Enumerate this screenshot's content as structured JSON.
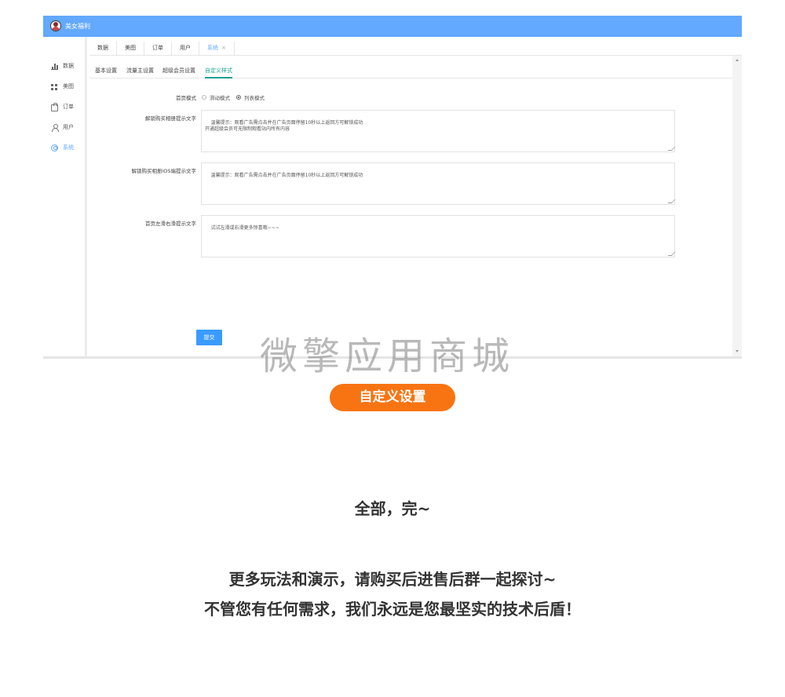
{
  "app": {
    "title": "美女福利"
  },
  "sidebar": {
    "items": [
      {
        "label": "数据",
        "icon": "bar-chart-icon"
      },
      {
        "label": "美图",
        "icon": "grid-icon"
      },
      {
        "label": "订单",
        "icon": "bag-icon"
      },
      {
        "label": "用户",
        "icon": "user-icon"
      },
      {
        "label": "系统",
        "icon": "gear-icon",
        "active": true
      }
    ]
  },
  "tabs": [
    {
      "label": "数据"
    },
    {
      "label": "美图"
    },
    {
      "label": "订单"
    },
    {
      "label": "用户"
    },
    {
      "label": "系统",
      "active": true,
      "close": "×"
    }
  ],
  "subtabs": [
    {
      "label": "基本设置"
    },
    {
      "label": "流量主设置"
    },
    {
      "label": "超级会员设置"
    },
    {
      "label": "自定义样式",
      "active": true
    }
  ],
  "form": {
    "home_mode_label": "首页模式",
    "home_mode_options": [
      "滑动模式",
      "列表模式"
    ],
    "home_mode_selected": "列表模式",
    "unlock_album_label": "解锁购买相册提示文字",
    "unlock_album_value": "温馨提示：观看广告需点击并在广告页面停留10秒以上返回方可解锁成功\n开通超级会员可无限制观看站内所有内容",
    "unlock_ios_label": "解锁购买相册iOS端提示文字",
    "unlock_ios_value": "温馨提示：观看广告需点击并在广告页面停留10秒以上返回方可解锁成功",
    "swipe_tip_label": "首页左滑右滑提示文字",
    "swipe_tip_value": "试试左滑或右滑更多惊喜哦~~~",
    "submit_label": "提交"
  },
  "watermark": "微擎应用商城",
  "promo": {
    "pill_label": "自定义设置",
    "done_text": "全部，完~",
    "line1": "更多玩法和演示，请购买后进售后群一起探讨~",
    "line2": "不管您有任何需求，我们永远是您最坚实的技术后盾！",
    "accent_color": "#f87412"
  },
  "colors": {
    "topbar": "#62a9ff",
    "active_subtab": "#1aa094",
    "submit": "#3a9bff"
  }
}
